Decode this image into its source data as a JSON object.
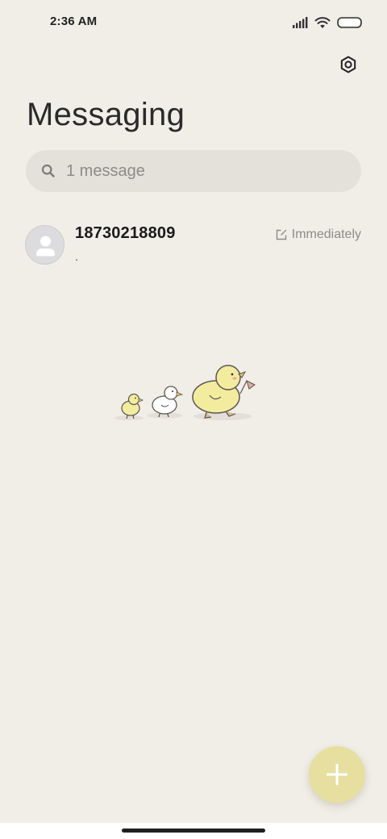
{
  "status_bar": {
    "time": "2:36 AM"
  },
  "header": {
    "title": "Messaging",
    "settings_icon": "settings-hexagon-icon"
  },
  "search": {
    "placeholder": "1 message"
  },
  "conversations": [
    {
      "sender": "18730218809",
      "preview": ".",
      "time": "Immediately",
      "time_icon": "scheduled-edit-icon"
    }
  ],
  "fab": {
    "icon": "plus-icon"
  },
  "colors": {
    "background": "#f1eee8",
    "search_bg": "#e4e1db",
    "fab": "#e6dfa0",
    "duck_yellow": "#f3ec9f"
  }
}
